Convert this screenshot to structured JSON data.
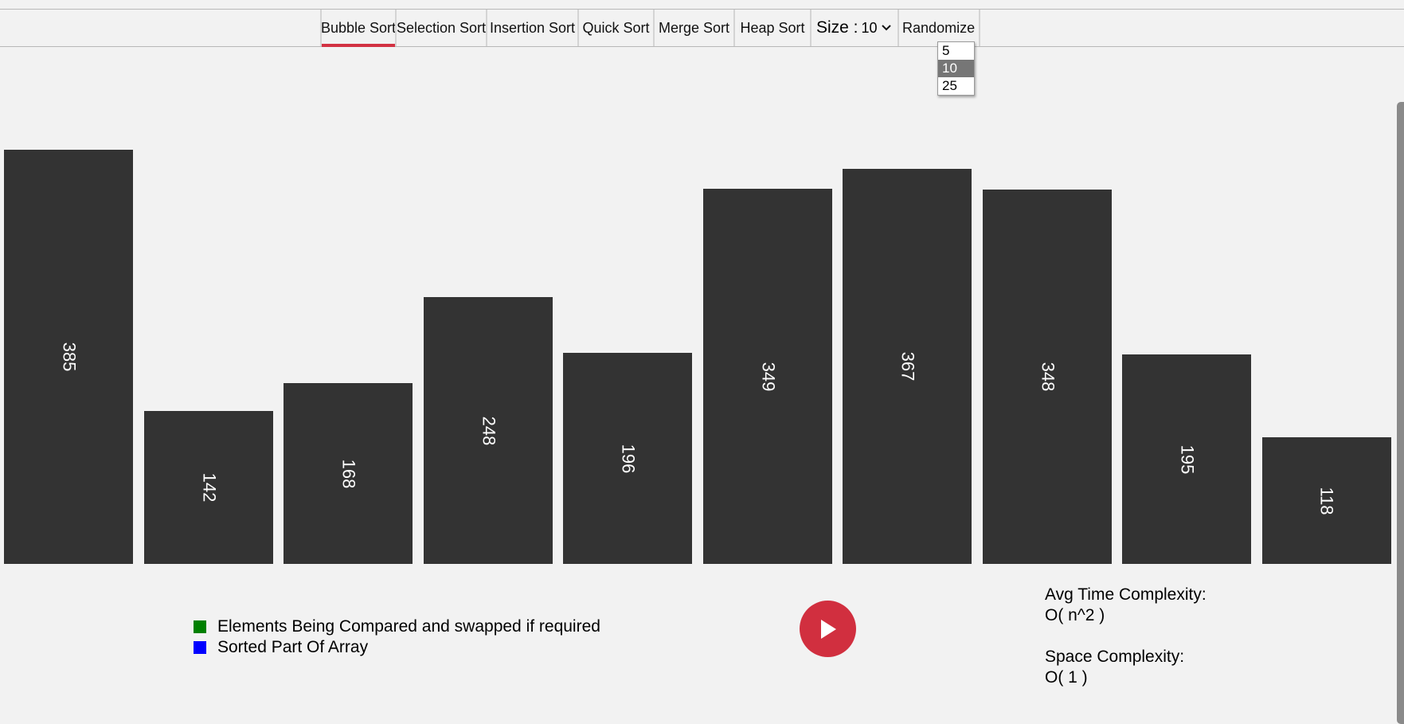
{
  "toolbar": {
    "tabs": [
      "Bubble Sort",
      "Selection Sort",
      "Insertion Sort",
      "Quick Sort",
      "Merge Sort",
      "Heap Sort"
    ],
    "active_tab": "Bubble Sort",
    "size_label": "Size :",
    "size_value": "10",
    "randomize_label": "Randomize"
  },
  "size_dropdown": {
    "options": [
      "5",
      "10",
      "25"
    ],
    "selected": "10"
  },
  "array": {
    "values": [
      385,
      142,
      168,
      248,
      196,
      349,
      367,
      348,
      195,
      118
    ],
    "labels": [
      "385",
      "142",
      "168",
      "248",
      "196",
      "349",
      "367",
      "348",
      "195",
      "118"
    ],
    "bar_color": "#333333",
    "max_value": 385
  },
  "legend": {
    "items": [
      {
        "label": "Elements Being Compared and swapped if required",
        "color": "#008000"
      },
      {
        "label": "Sorted Part Of Array",
        "color": "#0000ff"
      }
    ]
  },
  "controls": {
    "play_icon": "play-icon",
    "play_color": "#d12f3f"
  },
  "complexity": {
    "time_label": "Avg Time Complexity:",
    "time_value": "O( n^2 )",
    "space_label": "Space Complexity:",
    "space_value": "O( 1 )"
  },
  "accent_color": "#d23243"
}
